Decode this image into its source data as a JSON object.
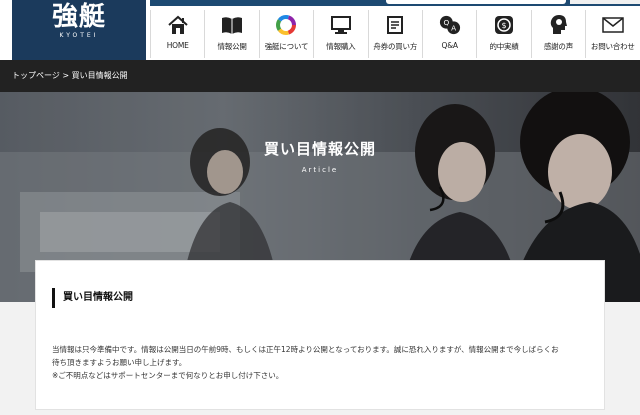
{
  "logo": {
    "main": "強艇",
    "sub": "KYOTEI"
  },
  "nav": [
    {
      "label": "HOME",
      "icon": "house-icon"
    },
    {
      "label": "情報公開",
      "icon": "book-icon"
    },
    {
      "label": "強艇について",
      "icon": "color-ring-icon"
    },
    {
      "label": "情報購入",
      "icon": "monitor-icon"
    },
    {
      "label": "舟券の買い方",
      "icon": "ticket-icon"
    },
    {
      "label": "Q&A",
      "icon": "qa-bubbles-icon"
    },
    {
      "label": "的中実績",
      "icon": "money-icon"
    },
    {
      "label": "感謝の声",
      "icon": "head-icon"
    },
    {
      "label": "お問い合わせ",
      "icon": "envelope-icon"
    }
  ],
  "breadcrumb": {
    "text": "トップページ > 買い目情報公開"
  },
  "hero": {
    "title": "買い目情報公開",
    "subtitle": "Article"
  },
  "article": {
    "heading": "買い目情報公開",
    "lines": [
      "当情報は只今準備中です。情報は公開当日の午前9時、もしくは正午12時より公開となっております。誠に恐れ入りますが、情報公開まで今しばらくお",
      "待ち頂きますようお願い申し上げます。",
      "※ご不明点などはサポートセンターまで何なりとお申し付け下さい。"
    ]
  },
  "colors": {
    "navy": "#1b3a5c",
    "topbar": "#1d4a72",
    "breadcrumb_bg": "#222222"
  }
}
